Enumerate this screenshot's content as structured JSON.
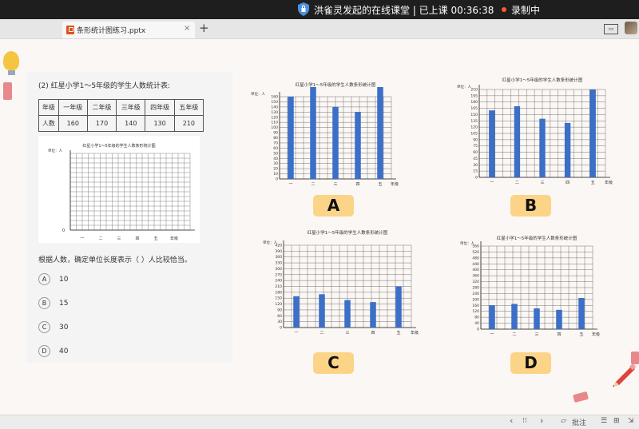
{
  "topbar": {
    "title": "洪雀灵发起的在线课堂 | 已上课 00:36:38",
    "recording": "录制中"
  },
  "tab": {
    "filename": "条形统计图练习.pptx",
    "close": "×",
    "new": "+"
  },
  "worksheet": {
    "question_title": "(2) 红星小学1～5年级的学生人数统计表:",
    "table": {
      "header": [
        "年级",
        "一年级",
        "二年级",
        "三年级",
        "四年级",
        "五年级"
      ],
      "row": [
        "人数",
        "160",
        "170",
        "140",
        "130",
        "210"
      ]
    },
    "chart_title": "红星小学1～5年级的学生人数条形统计图",
    "unit_label": "单位：人",
    "zero_label": "0",
    "grade_labels": [
      "一",
      "二",
      "三",
      "四",
      "五"
    ],
    "axis_label": "年级",
    "question_text": "根据人数，确定单位长度表示（  ）人比较恰当。",
    "options": [
      {
        "letter": "A",
        "value": "10"
      },
      {
        "letter": "B",
        "value": "15"
      },
      {
        "letter": "C",
        "value": "30"
      },
      {
        "letter": "D",
        "value": "40"
      }
    ]
  },
  "badges": [
    "A",
    "B",
    "C",
    "D"
  ],
  "bottombar": {
    "prev": "‹",
    "next": "›",
    "annotate": "批注"
  },
  "colors": {
    "bar": "#3b6fc8",
    "badge": "#fbd488",
    "topbar": "#1e1e1e"
  },
  "chart_data": [
    {
      "type": "bar",
      "title": "红星小学1～5年级的学生人数条形统计图",
      "ylabel": "单位：人",
      "xlabel": "年级",
      "categories": [
        "一",
        "二",
        "三",
        "四",
        "五"
      ],
      "values": [
        160,
        170,
        140,
        130,
        210
      ],
      "yticks": [
        10,
        20,
        30,
        40,
        50,
        60,
        70,
        80,
        90,
        100,
        110,
        120,
        130,
        140,
        150,
        160
      ],
      "ylim": [
        0,
        160
      ]
    },
    {
      "type": "bar",
      "title": "红星小学1～5年级的学生人数条形统计图",
      "ylabel": "单位：人",
      "xlabel": "年级",
      "categories": [
        "一",
        "二",
        "三",
        "四",
        "五"
      ],
      "values": [
        160,
        170,
        140,
        130,
        210
      ],
      "yticks": [
        15,
        30,
        45,
        60,
        75,
        90,
        105,
        120,
        135,
        150,
        165,
        180,
        195,
        210
      ],
      "ylim": [
        0,
        210
      ]
    },
    {
      "type": "bar",
      "title": "红星小学1～5年级的学生人数条形统计图",
      "ylabel": "单位：人",
      "xlabel": "年级",
      "categories": [
        "一",
        "二",
        "三",
        "四",
        "五"
      ],
      "values": [
        160,
        170,
        140,
        130,
        210
      ],
      "yticks": [
        30,
        60,
        90,
        120,
        150,
        180,
        210,
        240,
        270,
        300,
        330,
        360,
        390,
        420
      ],
      "ylim": [
        0,
        420
      ]
    },
    {
      "type": "bar",
      "title": "红星小学1～5年级的学生人数条形统计图",
      "ylabel": "单位：人",
      "xlabel": "年级",
      "categories": [
        "一",
        "二",
        "三",
        "四",
        "五"
      ],
      "values": [
        160,
        170,
        140,
        130,
        210
      ],
      "yticks": [
        40,
        80,
        120,
        160,
        200,
        240,
        280,
        320,
        360,
        400,
        440,
        480,
        520,
        560
      ],
      "ylim": [
        0,
        560
      ]
    }
  ]
}
